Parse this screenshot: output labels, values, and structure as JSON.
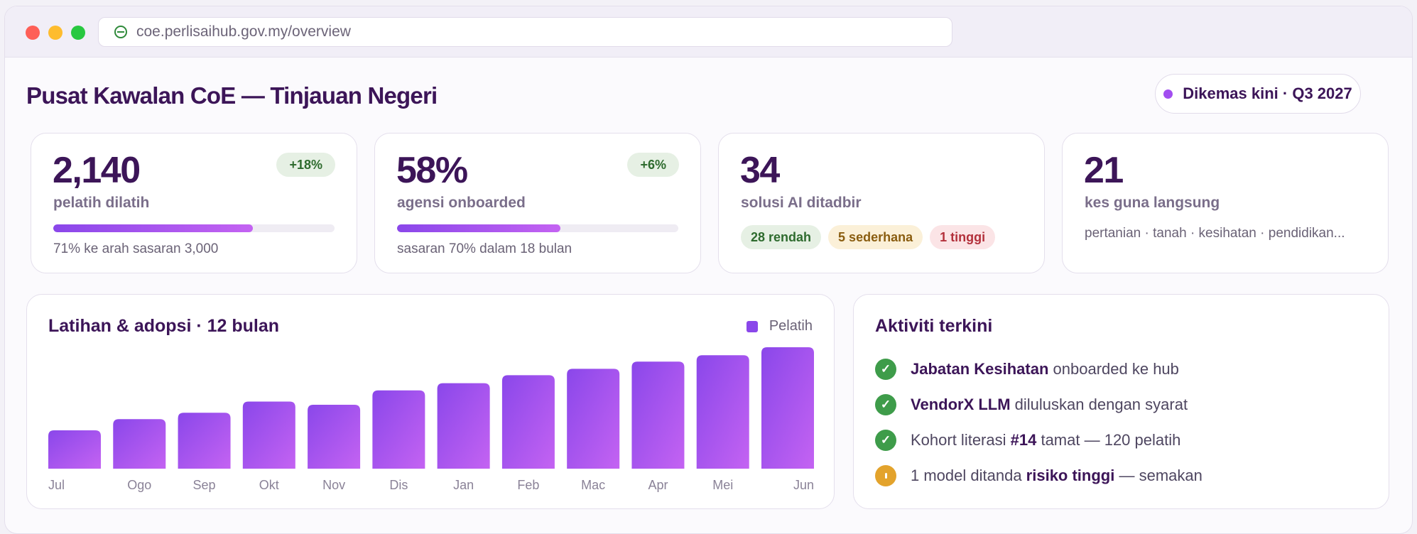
{
  "browser": {
    "url": "coe.perlisaihub.gov.my/overview"
  },
  "header": {
    "title": "Pusat Kawalan CoE — Tinjauan Negeri",
    "updated": "Dikemas kini · Q3 2027"
  },
  "kpis": [
    {
      "value": "2,140",
      "label": "pelatih dilatih",
      "delta": "+18%",
      "progress": 0.71,
      "note": "71% ke arah sasaran 3,000"
    },
    {
      "value": "58%",
      "label": "agensi onboarded",
      "delta": "+6%",
      "progress": 0.58,
      "note": "sasaran 70% dalam 18 bulan"
    },
    {
      "value": "34",
      "label": "solusi AI ditadbir",
      "chips": {
        "low": "28 rendah",
        "mid": "5 sederhana",
        "high": "1 tinggi"
      }
    },
    {
      "value": "21",
      "label": "kes guna langsung",
      "desc": "pertanian · tanah · kesihatan · pendidikan..."
    }
  ],
  "chart": {
    "title": "Latihan & adopsi · 12 bulan",
    "legend": "Pelatih"
  },
  "chart_data": {
    "type": "bar",
    "categories": [
      "Jul",
      "Ogo",
      "Sep",
      "Okt",
      "Nov",
      "Dis",
      "Jan",
      "Feb",
      "Mac",
      "Apr",
      "Mei",
      "Jun"
    ],
    "series": [
      {
        "name": "Pelatih",
        "values": [
          48,
          62,
          70,
          84,
          80,
          98,
          107,
          117,
          125,
          134,
          142,
          152
        ]
      }
    ],
    "ylim": [
      0,
      160
    ],
    "grid": false,
    "legend_position": "top-right",
    "color": "#8a47ea"
  },
  "activity": {
    "title": "Aktiviti terkini",
    "items": [
      {
        "status": "done",
        "strong": "Jabatan Kesihatan",
        "rest": " onboarded ke hub"
      },
      {
        "status": "done",
        "strong": "VendorX LLM",
        "rest": " diluluskan dengan syarat"
      },
      {
        "status": "done",
        "pre": "Kohort literasi ",
        "strong": "#14",
        "rest": " tamat — 120 pelatih"
      },
      {
        "status": "warn",
        "pre": "1 model ditanda ",
        "strong": "risiko tinggi",
        "rest": " — semakan"
      }
    ]
  },
  "colors": {
    "accent": "#8a47ea",
    "accent_end": "#c463f2",
    "title": "#3c1558",
    "success": "#3e9c4a",
    "warning": "#e3a32c"
  }
}
